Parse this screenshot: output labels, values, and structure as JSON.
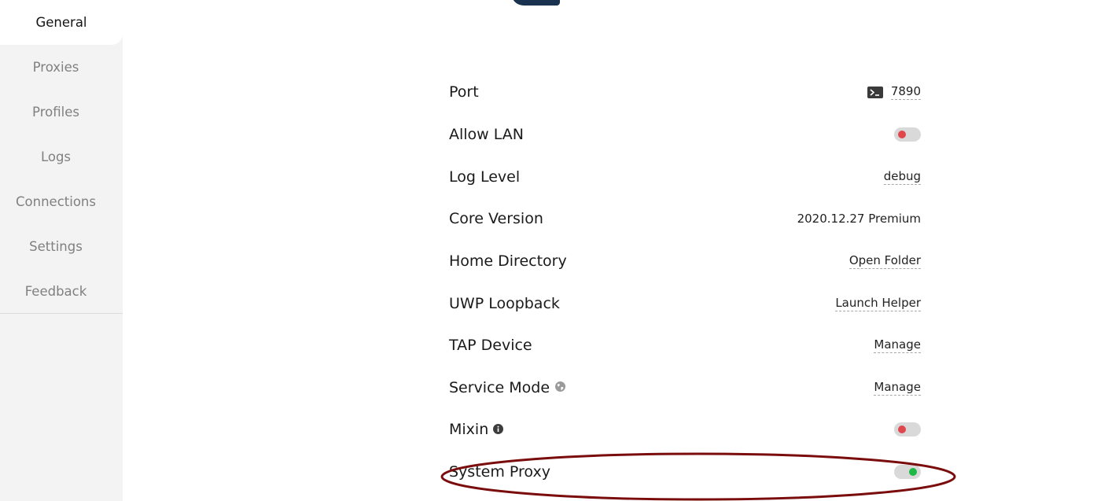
{
  "sidebar": {
    "items": [
      {
        "label": "General",
        "active": true
      },
      {
        "label": "Proxies",
        "active": false
      },
      {
        "label": "Profiles",
        "active": false
      },
      {
        "label": "Logs",
        "active": false
      },
      {
        "label": "Connections",
        "active": false
      },
      {
        "label": "Settings",
        "active": false
      },
      {
        "label": "Feedback",
        "active": false
      }
    ]
  },
  "settings": {
    "port": {
      "label": "Port",
      "value": "7890",
      "icon": "terminal-icon"
    },
    "allow_lan": {
      "label": "Allow LAN",
      "enabled": false
    },
    "log_level": {
      "label": "Log Level",
      "value": "debug"
    },
    "core_version": {
      "label": "Core Version",
      "value": "2020.12.27 Premium"
    },
    "home_directory": {
      "label": "Home Directory",
      "value": "Open Folder"
    },
    "uwp_loopback": {
      "label": "UWP Loopback",
      "value": "Launch Helper"
    },
    "tap_device": {
      "label": "TAP Device",
      "value": "Manage"
    },
    "service_mode": {
      "label": "Service Mode",
      "value": "Manage",
      "icon": "globe-icon"
    },
    "mixin": {
      "label": "Mixin",
      "enabled": false,
      "icon": "info-icon"
    },
    "system_proxy": {
      "label": "System Proxy",
      "enabled": true
    }
  },
  "colors": {
    "sidebar_bg": "#f3f3f3",
    "toggle_off": "#e0474c",
    "toggle_on": "#1eb845",
    "annotation": "#7a0c0c",
    "logo": "#19324f"
  }
}
